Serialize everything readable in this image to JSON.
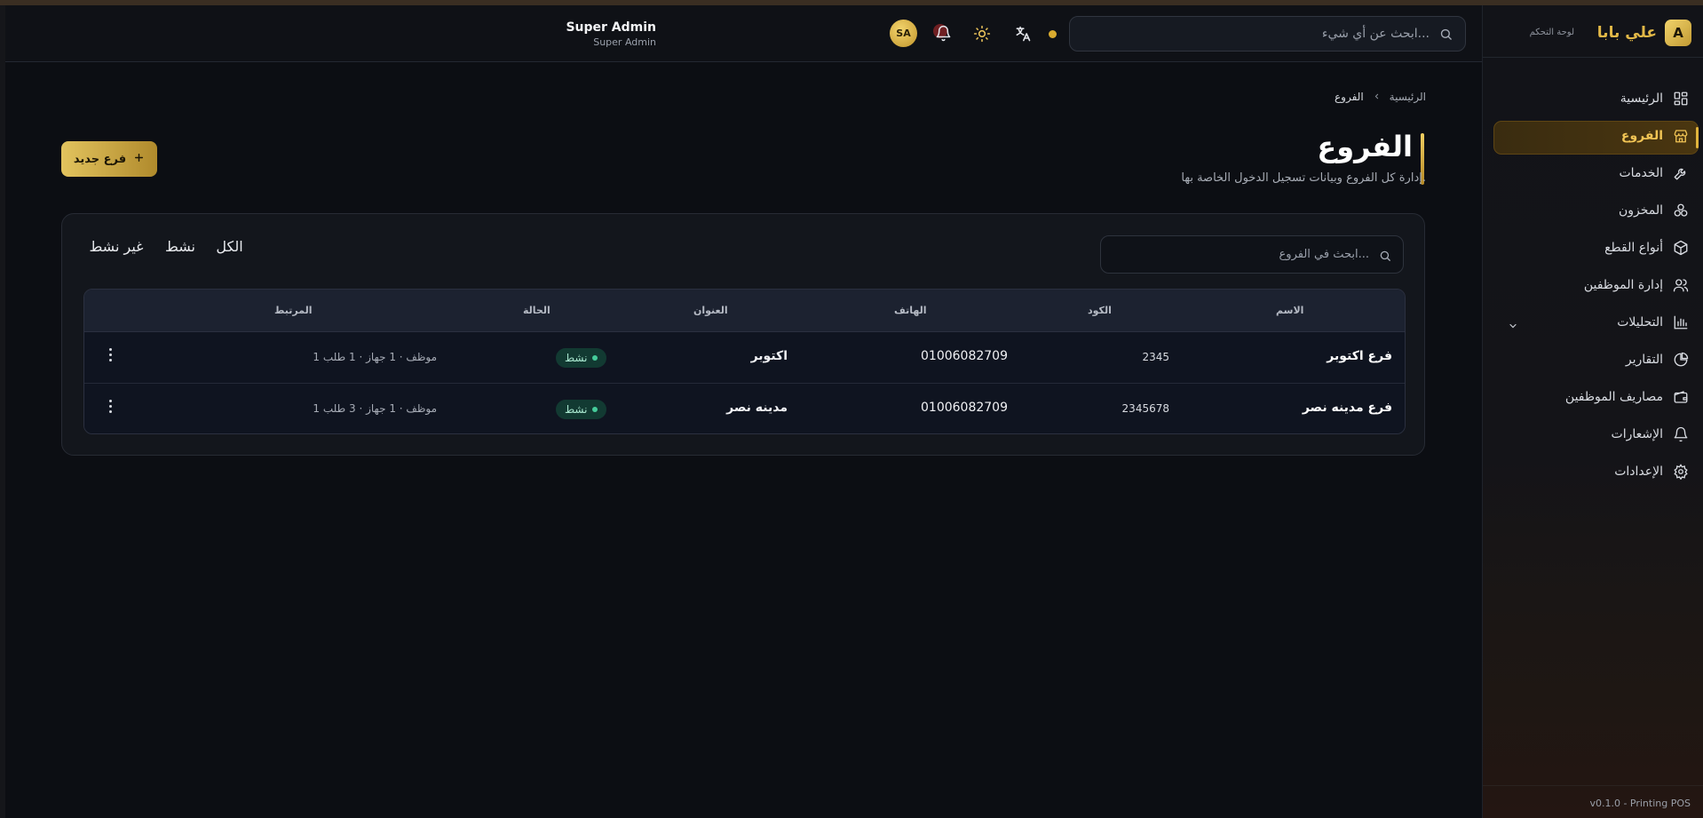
{
  "header": {
    "search_placeholder": "ابحث عن أي شيء...",
    "user_name": "Super Admin",
    "user_role": "Super Admin",
    "avatar_initials": "SA"
  },
  "sidebar": {
    "logo_letter": "A",
    "brand": "علي بابا",
    "brand_sub": "لوحة التحكم",
    "items": [
      {
        "label": "الرئيسية",
        "icon": "dashboard-icon"
      },
      {
        "label": "الفروع",
        "icon": "store-icon",
        "active": true
      },
      {
        "label": "الخدمات",
        "icon": "wrench-icon"
      },
      {
        "label": "المخزون",
        "icon": "boxes-icon"
      },
      {
        "label": "أنواع القطع",
        "icon": "package-icon"
      },
      {
        "label": "إدارة الموظفين",
        "icon": "users-icon"
      },
      {
        "label": "التحليلات",
        "icon": "bar-chart-icon"
      },
      {
        "label": "التقارير",
        "icon": "pie-chart-icon"
      },
      {
        "label": "مصاريف الموظفين",
        "icon": "wallet-icon"
      },
      {
        "label": "الإشعارات",
        "icon": "bell-icon"
      },
      {
        "label": "الإعدادات",
        "icon": "gear-icon"
      }
    ],
    "version": "v0.1.0 - Printing POS"
  },
  "breadcrumb": {
    "home": "الرئيسية",
    "current": "الفروع"
  },
  "page": {
    "title": "الفروع",
    "subtitle": "إدارة كل الفروع وبيانات تسجيل الدخول الخاصة بها.",
    "new_button": "فرع جديد"
  },
  "card": {
    "search_placeholder": "ابحث في الفروع...",
    "filters": [
      "الكل",
      "نشط",
      "غير نشط"
    ],
    "active_filter": "الكل"
  },
  "table": {
    "headers": {
      "name": "الاسم",
      "code": "الكود",
      "phone": "الهاتف",
      "address": "العنوان",
      "status": "الحالة",
      "related": "المرتبط"
    },
    "rows": [
      {
        "name": "فرع اكتوبر",
        "code": "2345",
        "phone": "01006082709",
        "address": "اكتوبر",
        "status": "نشط",
        "related": "1 موظف · 1 جهاز · 1 طلب"
      },
      {
        "name": "فرع مدينه نصر",
        "code": "2345678",
        "phone": "01006082709",
        "address": "مدينه نصر",
        "status": "نشط",
        "related": "1 موظف · 1 جهاز · 3 طلب"
      }
    ]
  },
  "colors": {
    "accent": "#e0b33c",
    "background": "#0c0e13",
    "status_active": "#45cb9a"
  }
}
